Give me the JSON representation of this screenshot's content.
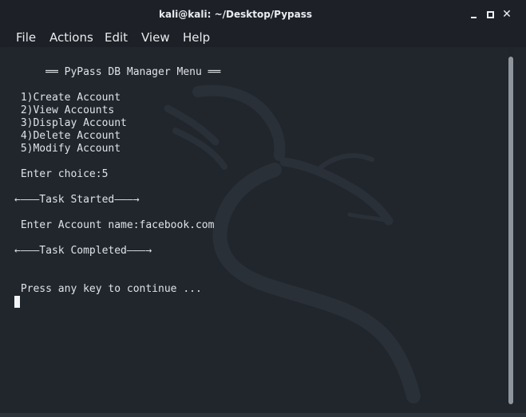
{
  "window": {
    "title": "kali@kali: ~/Desktop/Pypass"
  },
  "menu": {
    "items": [
      "File",
      "Actions",
      "Edit",
      "View",
      "Help"
    ]
  },
  "terminal": {
    "lines": [
      "     ══ PyPass DB Manager Menu ══",
      "",
      " 1)Create Account",
      " 2)View Accounts",
      " 3)Display Account",
      " 4)Delete Account",
      " 5)Modify Account",
      "",
      " Enter choice:5",
      "",
      "←———Task Started———→",
      "",
      " Enter Account name:facebook.com",
      "",
      "←———Task Completed———→",
      "",
      "",
      " Press any key to continue ..."
    ]
  },
  "icons": {
    "minimize": "minimize-icon",
    "maximize": "maximize-icon",
    "close": "close-icon",
    "cursor": "terminal-cursor"
  },
  "colors": {
    "background": "#23272e",
    "titlebar": "#1d2127",
    "text": "#dfe3e8"
  }
}
